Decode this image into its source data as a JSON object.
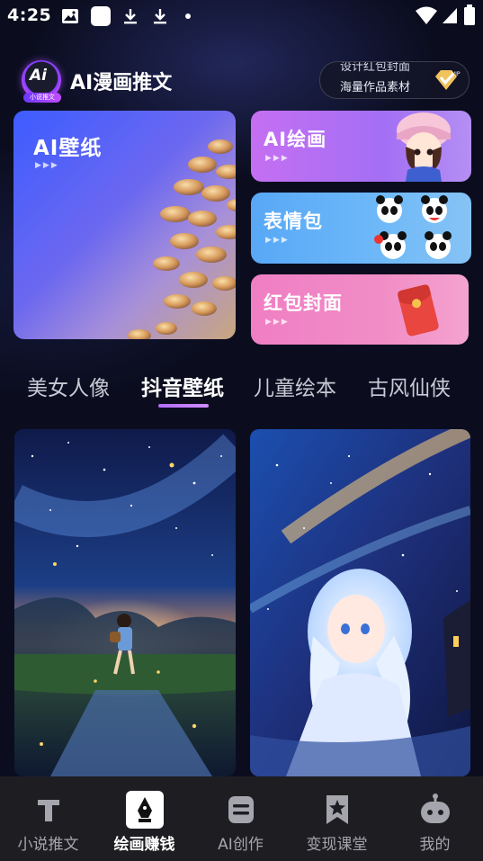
{
  "status_bar": {
    "time": "4:25",
    "left_icons": [
      "image-icon",
      "app-square-icon",
      "download-icon",
      "download-icon",
      "dot-icon"
    ],
    "right_icons": [
      "wifi-icon",
      "signal-icon",
      "battery-icon"
    ]
  },
  "header": {
    "logo_text": "Ai",
    "logo_tag": "小说推文",
    "title": "AI漫画推文",
    "vip_line1": "设计红包封面",
    "vip_line2": "海量作品素材",
    "vip_badge": "VIP"
  },
  "features": {
    "wallpaper": {
      "label": "AI壁纸",
      "arrows": "▶▶▶"
    },
    "painting": {
      "label": "AI绘画",
      "arrows": "▶▶▶"
    },
    "emoji": {
      "label": "表情包",
      "arrows": "▶▶▶"
    },
    "red_packet": {
      "label": "红包封面",
      "arrows": "▶▶▶"
    }
  },
  "tabs": [
    {
      "label": "美女人像",
      "active": false
    },
    {
      "label": "抖音壁纸",
      "active": true
    },
    {
      "label": "儿童绘本",
      "active": false
    },
    {
      "label": "古风仙侠",
      "active": false
    }
  ],
  "gallery": [
    {
      "subject": "girl walking under starry sky"
    },
    {
      "subject": "white-haired anime girl under starry sky"
    }
  ],
  "bottom_nav": [
    {
      "label": "小说推文",
      "icon": "text-t-icon",
      "active": false
    },
    {
      "label": "绘画赚钱",
      "icon": "pen-nib-icon",
      "active": true
    },
    {
      "label": "AI创作",
      "icon": "ai-creation-icon",
      "active": false
    },
    {
      "label": "变现课堂",
      "icon": "bookmark-star-icon",
      "active": false
    },
    {
      "label": "我的",
      "icon": "robot-profile-icon",
      "active": false
    }
  ],
  "colors": {
    "background": "#0b0d1f",
    "tab_indicator": "#b46cff",
    "nav_background": "#1e1e22"
  }
}
